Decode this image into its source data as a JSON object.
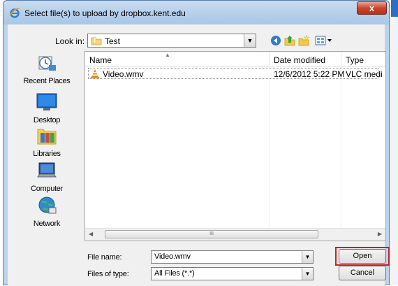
{
  "window": {
    "title": "Select file(s) to upload by dropbox.kent.edu",
    "close_label": "x"
  },
  "lookin": {
    "label": "Look in:",
    "value": "Test"
  },
  "places": [
    {
      "label": "Recent Places",
      "icon": "recent-places-icon"
    },
    {
      "label": "Desktop",
      "icon": "desktop-icon"
    },
    {
      "label": "Libraries",
      "icon": "libraries-icon"
    },
    {
      "label": "Computer",
      "icon": "computer-icon"
    },
    {
      "label": "Network",
      "icon": "network-icon"
    }
  ],
  "filelist": {
    "columns": [
      "Name",
      "Date modified",
      "Type"
    ],
    "rows": [
      {
        "name": "Video.wmv",
        "date": "12/6/2012 5:22 PM",
        "type": "VLC medi",
        "icon": "vlc-cone-icon"
      }
    ],
    "scroll_grip": "III"
  },
  "form": {
    "filename_label": "File name:",
    "filename_value": "Video.wmv",
    "filetype_label": "Files of type:",
    "filetype_value": "All Files (*.*)",
    "open_label": "Open",
    "cancel_label": "Cancel"
  },
  "colors": {
    "highlight": "#d01c1c",
    "titlebar": "#bcd3ec",
    "close": "#c9462c"
  }
}
